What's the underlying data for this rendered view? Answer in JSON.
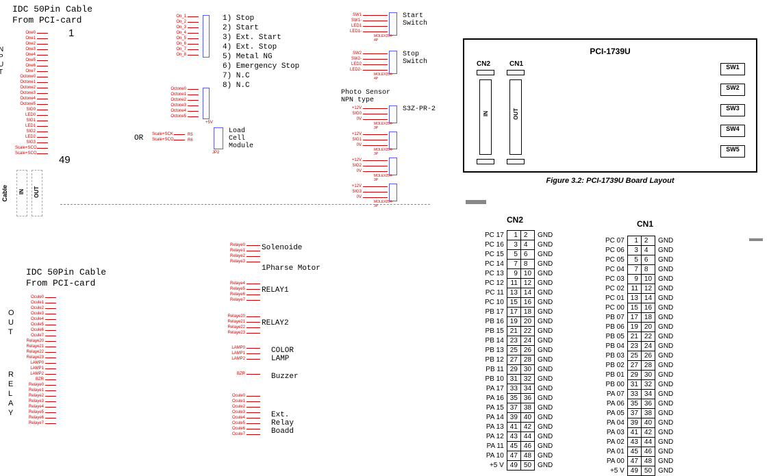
{
  "left": {
    "idc_title1a": "IDC  50Pin  Cable",
    "idc_title1b": "From   PCI-card",
    "pin1": "1",
    "pin49": "49",
    "input_vert": "I N P U T",
    "cable_vert": "Cable",
    "in": "IN",
    "out": "OUT",
    "idc_title2a": "IDC  50Pin  Cable",
    "idc_title2b": "From   PCI-card",
    "out_vert": "O U T",
    "relay_vert": "R E L A Y",
    "input_pins": [
      "One0",
      "One1",
      "One2",
      "One3",
      "One4",
      "One5",
      "One6",
      "One7",
      "Octone0",
      "Octone1",
      "Octone2",
      "Octone3",
      "Octone4",
      "Octone5",
      "SIG0",
      "LED0",
      "SIG1",
      "LED1",
      "SIG2",
      "LED2",
      "SIG3",
      "Scale+SCO",
      "Scale+SCO"
    ],
    "mid_pins": [
      "On_1",
      "On_2",
      "On_3",
      "On_4",
      "On_5",
      "On_6",
      "On_7",
      "On_8"
    ],
    "oct_pins": [
      "Octone0",
      "Octone1",
      "Octone2",
      "Octone3",
      "Octone4",
      "Octone5"
    ],
    "or": "OR",
    "loadcell": {
      "sck_a": "Scale+SCK",
      "sco_a": "Scale+SCO",
      "lbl": "Load\nCell\nModule",
      "r5": "R5",
      "r6": "R6",
      "plus5v": "+5V",
      "jp2": "JP2"
    },
    "commands": [
      "1) Stop",
      "2) Start",
      "3) Ext. Start",
      "4) Ext. Stop",
      "5) Metal NG",
      "6) Emergency Stop",
      "7) N.C",
      "8) N.C"
    ],
    "start_sw": {
      "pins": [
        "SW1",
        "SW1-",
        "LED1",
        "LED1-"
      ],
      "lbl": "Start\nSwitch",
      "foot": "MOLEX254-4P"
    },
    "stop_sw": {
      "pins": [
        "SW2",
        "SW2-",
        "LED2",
        "LED2-"
      ],
      "lbl": "Stop\nSwitch",
      "foot": "MOLEX254-4P"
    },
    "photo": {
      "title": "Photo Sensor\nNPN type",
      "lbl": "S3Z-PR-2",
      "pins": [
        "+12V",
        "SIG0",
        "0V"
      ],
      "foot": "MOLEX254-3P"
    },
    "sensors_extra": [
      [
        "+12V",
        "SIG1",
        "0V"
      ],
      [
        "+12V",
        "SIG2",
        "0V"
      ],
      [
        "+12V",
        "SIG3",
        "0V"
      ]
    ],
    "out_left": [
      "Ocule0",
      "Ocule1",
      "Ocule2",
      "Ocule3",
      "Ocule4",
      "Ocule5",
      "Ocule6",
      "Ocule7",
      "Relaye20",
      "Relaye21",
      "Relaye22",
      "Relaye23",
      "LAMP0",
      "LAMP1",
      "LAMP2",
      "BZR",
      "Relaye0",
      "Relaye1",
      "Relaye2",
      "Relaye3",
      "Relaye4",
      "Relaye5",
      "Relaye6",
      "Relaye7"
    ],
    "sol": {
      "pins": [
        "Relaye0",
        "Relaye1",
        "Relaye2"
      ],
      "lbl": "Solenoide"
    },
    "motor": {
      "pins": [
        "Relaye3"
      ],
      "lbl": "1Pharse Motor"
    },
    "r1": {
      "pins": [
        "Relaye4",
        "Relaye5",
        "Relaye6",
        "Relaye7"
      ],
      "lbl": "RELAY1"
    },
    "r2": {
      "pins": [
        "Relaye20",
        "Relaye21",
        "Relaye22",
        "Relaye23"
      ],
      "lbl": "RELAY2"
    },
    "lamp": {
      "pins": [
        "LAMP0",
        "LAMP1",
        "LAMP2"
      ],
      "lbl": "COLOR\nLAMP"
    },
    "buz": {
      "pins": [
        "BZR"
      ],
      "lbl": "Buzzer"
    },
    "ext": {
      "pins": [
        "Ocule0",
        "Ocule1",
        "Ocule2",
        "Ocule3",
        "Ocule4",
        "Ocule5",
        "Ocule6",
        "Ocule7"
      ],
      "lbl": "Ext.\nRelay\nBoadd"
    }
  },
  "board": {
    "title": "PCI-1739U",
    "cn2": "CN2",
    "cn1": "CN1",
    "in": "IN",
    "out": "OUT",
    "sw": [
      "SW1",
      "SW2",
      "SW3",
      "SW4",
      "SW5"
    ],
    "caption": "Figure 3.2: PCI-1739U Board Layout"
  },
  "cn2": {
    "title": "CN2",
    "rows": [
      [
        "PC 17",
        "1",
        "2",
        "GND"
      ],
      [
        "PC 16",
        "3",
        "4",
        "GND"
      ],
      [
        "PC 15",
        "5",
        "6",
        "GND"
      ],
      [
        "PC 14",
        "7",
        "8",
        "GND"
      ],
      [
        "PC 13",
        "9",
        "10",
        "GND"
      ],
      [
        "PC 12",
        "11",
        "12",
        "GND"
      ],
      [
        "PC 11",
        "13",
        "14",
        "GND"
      ],
      [
        "PC 10",
        "15",
        "16",
        "GND"
      ],
      [
        "PB 17",
        "17",
        "18",
        "GND"
      ],
      [
        "PB 16",
        "19",
        "20",
        "GND"
      ],
      [
        "PB 15",
        "21",
        "22",
        "GND"
      ],
      [
        "PB 14",
        "23",
        "24",
        "GND"
      ],
      [
        "PB 13",
        "25",
        "26",
        "GND"
      ],
      [
        "PB 12",
        "27",
        "28",
        "GND"
      ],
      [
        "PB 11",
        "29",
        "30",
        "GND"
      ],
      [
        "PB 10",
        "31",
        "32",
        "GND"
      ],
      [
        "PA 17",
        "33",
        "34",
        "GND"
      ],
      [
        "PA 16",
        "35",
        "36",
        "GND"
      ],
      [
        "PA 15",
        "37",
        "38",
        "GND"
      ],
      [
        "PA 14",
        "39",
        "40",
        "GND"
      ],
      [
        "PA 13",
        "41",
        "42",
        "GND"
      ],
      [
        "PA 12",
        "43",
        "44",
        "GND"
      ],
      [
        "PA 11",
        "45",
        "46",
        "GND"
      ],
      [
        "PA 10",
        "47",
        "48",
        "GND"
      ],
      [
        "+5 V",
        "49",
        "50",
        "GND"
      ]
    ]
  },
  "cn1": {
    "title": "CN1",
    "rows": [
      [
        "PC 07",
        "1",
        "2",
        "GND"
      ],
      [
        "PC 06",
        "3",
        "4",
        "GND"
      ],
      [
        "PC 05",
        "5",
        "6",
        "GND"
      ],
      [
        "PC 04",
        "7",
        "8",
        "GND"
      ],
      [
        "PC 03",
        "9",
        "10",
        "GND"
      ],
      [
        "PC 02",
        "11",
        "12",
        "GND"
      ],
      [
        "PC 01",
        "13",
        "14",
        "GND"
      ],
      [
        "PC 00",
        "15",
        "16",
        "GND"
      ],
      [
        "PB 07",
        "17",
        "18",
        "GND"
      ],
      [
        "PB 06",
        "19",
        "20",
        "GND"
      ],
      [
        "PB 05",
        "21",
        "22",
        "GND"
      ],
      [
        "PB 04",
        "23",
        "24",
        "GND"
      ],
      [
        "PB 03",
        "25",
        "26",
        "GND"
      ],
      [
        "PB 02",
        "27",
        "28",
        "GND"
      ],
      [
        "PB 01",
        "29",
        "30",
        "GND"
      ],
      [
        "PB 00",
        "31",
        "32",
        "GND"
      ],
      [
        "PA 07",
        "33",
        "34",
        "GND"
      ],
      [
        "PA 06",
        "35",
        "36",
        "GND"
      ],
      [
        "PA 05",
        "37",
        "38",
        "GND"
      ],
      [
        "PA 04",
        "39",
        "40",
        "GND"
      ],
      [
        "PA 03",
        "41",
        "42",
        "GND"
      ],
      [
        "PA 02",
        "43",
        "44",
        "GND"
      ],
      [
        "PA 01",
        "45",
        "46",
        "GND"
      ],
      [
        "PA 00",
        "47",
        "48",
        "GND"
      ],
      [
        "+5 V",
        "49",
        "50",
        "GND"
      ]
    ]
  }
}
